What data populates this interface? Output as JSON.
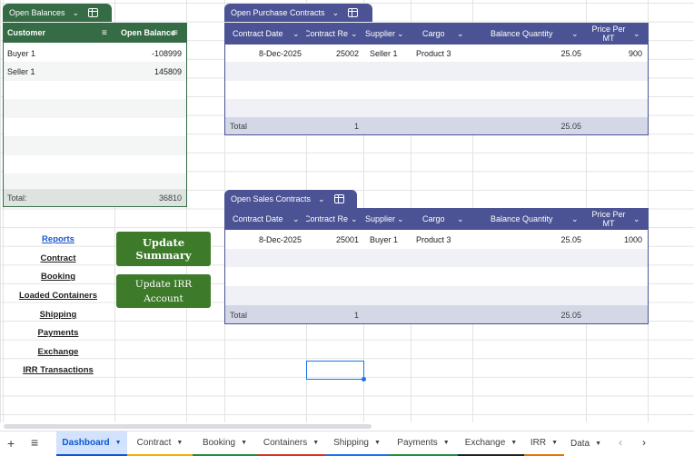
{
  "balances": {
    "tab_label": "Open Balances",
    "col_customer": "Customer",
    "col_balance": "Open Balance",
    "rows": [
      {
        "customer": "Buyer 1",
        "balance": "-108999"
      },
      {
        "customer": "Seller 1",
        "balance": "145809"
      }
    ],
    "total_label": "Total:",
    "total_value": "36810"
  },
  "purchase": {
    "tab_label": "Open Purchase Contracts",
    "headers": [
      "Contract Date",
      "Contract Re",
      "Supplier",
      "Cargo",
      "Balance Quantity",
      "Price Per MT"
    ],
    "row": {
      "date": "8-Dec-2025",
      "ref": "25002",
      "party": "Seller 1",
      "cargo": "Product 3",
      "qty": "25.05",
      "price": "900"
    },
    "total_label": "Total",
    "total_ref": "1",
    "total_qty": "25.05"
  },
  "sales": {
    "tab_label": "Open Sales Contracts",
    "headers": [
      "Contract Date",
      "Contract Re",
      "Supplier",
      "Cargo",
      "Balance Quantity",
      "Price Per MT"
    ],
    "row": {
      "date": "8-Dec-2025",
      "ref": "25001",
      "party": "Buyer 1",
      "cargo": "Product 3",
      "qty": "25.05",
      "price": "1000"
    },
    "total_label": "Total",
    "total_ref": "1",
    "total_qty": "25.05"
  },
  "links": [
    "Reports",
    "Contract",
    "Booking",
    "Loaded Containers",
    "Shipping",
    "Payments",
    "Exchange",
    "IRR Transactions"
  ],
  "buttons": {
    "update_summary": "Update Summary",
    "update_irr": "Update IRR Account"
  },
  "sheet_tabs": [
    "Dashboard",
    "Contract",
    "Booking",
    "Containers",
    "Shipping",
    "Payments",
    "Exchange",
    "IRR",
    "Data"
  ],
  "colors": {
    "green_header": "#356b45",
    "navy_header": "#4b5394",
    "button_green": "#3d7a2a",
    "active_tab": "#d3e3fd"
  },
  "icons": [
    "add-sheet-icon",
    "all-sheets-icon",
    "table-icon",
    "filter-icon",
    "chevron-down-icon"
  ]
}
